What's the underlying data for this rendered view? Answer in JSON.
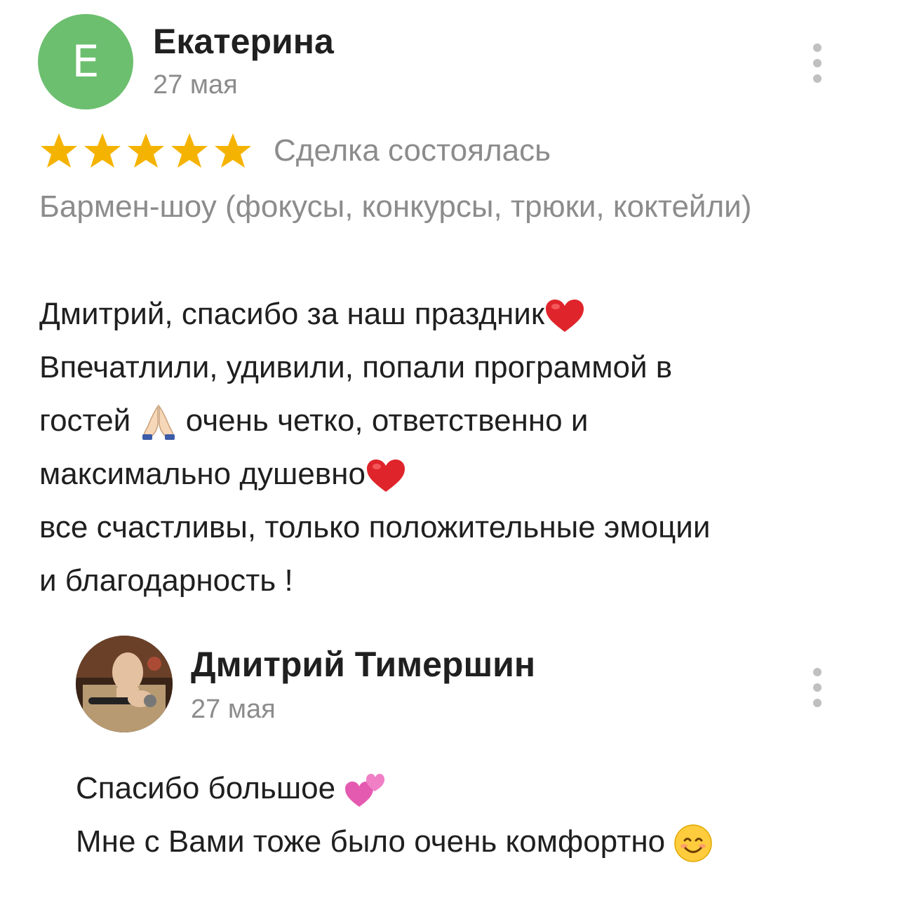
{
  "review": {
    "author_initial": "Е",
    "author_name": "Екатерина",
    "date": "27 мая",
    "rating": 5,
    "rating_max": 5,
    "deal_status": "Сделка состоялась",
    "service": "Бармен-шоу (фокусы, конкурсы, трюки, коктейли)",
    "text_lines": [
      "Дмитрий, спасибо за наш праздник",
      "Впечатлили, удивили, попали программой в",
      "гостей",
      "очень четко, ответственно и",
      "максимально душевно",
      "все счастливы, только положительные эмоции",
      "и благодарность !"
    ],
    "emojis": [
      "red-heart",
      "folded-hands",
      "red-heart"
    ]
  },
  "reply": {
    "author_name": "Дмитрий Тимершин",
    "date": "27 мая",
    "text_lines": [
      "Спасибо большое",
      "Мне с Вами тоже было очень комфортно"
    ],
    "emojis": [
      "two-hearts",
      "smiling-face"
    ]
  },
  "colors": {
    "avatar_bg": "#6cbf6f",
    "star": "#f5b301",
    "muted_text": "#8c8c8c",
    "text": "#1f1f1f"
  },
  "icons": [
    "more-vertical-icon",
    "star-icon"
  ]
}
